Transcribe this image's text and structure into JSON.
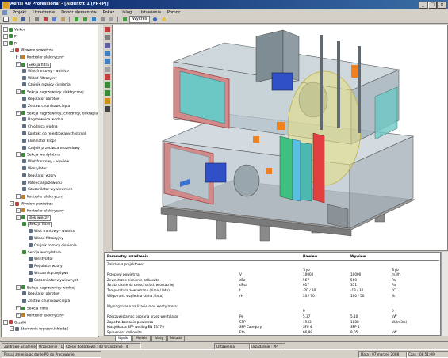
{
  "title": "Aerisl AD Professional - [Aldur.ttt_1 (PP+P)]",
  "menu": [
    "Projekt",
    "Urzadzenie",
    "Dobór elementów",
    "Pokaz",
    "Uslugi",
    "Ustawienia",
    "Pomoc"
  ],
  "toolbar": {
    "wykres_label": "Wykres"
  },
  "tree": [
    {
      "label": "Vaikon",
      "depth": 0,
      "color": "#3a8a3a"
    },
    {
      "label": "P",
      "depth": 0,
      "color": "#3a8a3a"
    },
    {
      "label": "P",
      "depth": 0,
      "color": "#3a8a3a"
    },
    {
      "label": "Wywiew powietrza",
      "depth": 1,
      "color": "#c04040"
    },
    {
      "label": "Kontroler elektryczny",
      "depth": 2,
      "color": "#c08020"
    },
    {
      "label": "Sekcja filtra",
      "depth": 2,
      "color": "#3a8a3a",
      "box": true
    },
    {
      "label": "Wlot frontowy - wolnice",
      "depth": 3,
      "color": "#607080"
    },
    {
      "label": "Wklad filtracyjny",
      "depth": 3,
      "color": "#607080"
    },
    {
      "label": "Czujnik roznicy cisnienia",
      "depth": 3,
      "color": "#607080"
    },
    {
      "label": "Sekcja nagrzewnicy elektrycznej",
      "depth": 2,
      "color": "#3a8a3a"
    },
    {
      "label": "Regulator obrotow",
      "depth": 3,
      "color": "#607080"
    },
    {
      "label": "Zestaw czujnikow ciepla",
      "depth": 3,
      "color": "#607080"
    },
    {
      "label": "Sekcja nagrzewnicy, chlodnicy, odkraplacz",
      "depth": 2,
      "color": "#3a8a3a"
    },
    {
      "label": "Nagrzewnica wodna",
      "depth": 3,
      "color": "#607080"
    },
    {
      "label": "Chlodnica wodna",
      "depth": 3,
      "color": "#607080"
    },
    {
      "label": "Kontakt do rejestrowanych skropli",
      "depth": 3,
      "color": "#607080"
    },
    {
      "label": "Eliminator kropli",
      "depth": 3,
      "color": "#607080"
    },
    {
      "label": "Czujnik przeciwzamrozeniowy",
      "depth": 3,
      "color": "#607080"
    },
    {
      "label": "Sekcja wentylatora",
      "depth": 2,
      "color": "#3a8a3a"
    },
    {
      "label": "Wlot frontowy - wywiew",
      "depth": 3,
      "color": "#607080"
    },
    {
      "label": "Wentylator",
      "depth": 3,
      "color": "#607080"
    },
    {
      "label": "Regulator wzory",
      "depth": 3,
      "color": "#607080"
    },
    {
      "label": "Potencjal przewodu",
      "depth": 3,
      "color": "#607080"
    },
    {
      "label": "Czasonilator wywiewnych",
      "depth": 3,
      "color": "#607080"
    },
    {
      "label": "Kontroler elektryczny",
      "depth": 2,
      "color": "#c08020"
    },
    {
      "label": "Wywiew powietrza",
      "depth": 1,
      "color": "#c04040"
    },
    {
      "label": "Kontroler elektryczny",
      "depth": 2,
      "color": "#c08020"
    },
    {
      "label": "Blok wieczy",
      "depth": 2,
      "color": "#3a8a3a",
      "box": true
    },
    {
      "label": "Sekcja filtra",
      "depth": 3,
      "color": "#3a8a3a",
      "box": true
    },
    {
      "label": "Wlot frontowy - wolnice",
      "depth": 4,
      "color": "#607080"
    },
    {
      "label": "Wklad filtracyjny",
      "depth": 4,
      "color": "#607080"
    },
    {
      "label": "Czujnik roznicy cisnienia",
      "depth": 4,
      "color": "#607080"
    },
    {
      "label": "Sekcja wentylatora",
      "depth": 3,
      "color": "#3a8a3a"
    },
    {
      "label": "Wentylator",
      "depth": 4,
      "color": "#607080"
    },
    {
      "label": "Regulator wzory",
      "depth": 4,
      "color": "#607080"
    },
    {
      "label": "Wskaznikprzeplywu",
      "depth": 4,
      "color": "#607080"
    },
    {
      "label": "Czasonilator wywiewnych",
      "depth": 4,
      "color": "#607080"
    },
    {
      "label": "Sekcja nagrzewnicy wodnej",
      "depth": 2,
      "color": "#3a8a3a"
    },
    {
      "label": "Regulator obrotow",
      "depth": 3,
      "color": "#607080"
    },
    {
      "label": "Zestaw czujnikow ciepla",
      "depth": 3,
      "color": "#607080"
    },
    {
      "label": "Sekcja filtra",
      "depth": 2,
      "color": "#3a8a3a"
    },
    {
      "label": "Kontroler elektryczny",
      "depth": 2,
      "color": "#c08020"
    },
    {
      "label": "Grzalki",
      "depth": 0,
      "color": "#c04040"
    },
    {
      "label": "Sterownik (ogrzew./chlodz.)",
      "depth": 1,
      "color": "#607080"
    }
  ],
  "panel": {
    "headers": {
      "c0": "Parametry urzadzenia",
      "c2": "Nawiew",
      "c4": "Wywiew"
    },
    "rows": [
      {
        "c0": "Zalozenia projektowe:"
      },
      {
        "c0": "",
        "c2": "Tryb",
        "c4": "Tryb"
      },
      {
        "c0": "Przeplyw powietrza",
        "c1": "V",
        "c2": "10000",
        "c3": "10000",
        "c4": "m3/h"
      },
      {
        "c0": "Zewnetrzne cisnienie calkowite",
        "c1": "dPz",
        "c2": "567",
        "c3": "560",
        "c4": "Pa"
      },
      {
        "c0": "Strata cisnienia czesci sklad. w ostatniej",
        "c1": "dPsa",
        "c2": "617",
        "c3": "351",
        "c4": "Pa"
      },
      {
        "c0": "Temperatura zewnetrzna (zima / lato)",
        "c1": "t",
        "c2": "-20 / 30",
        "c3": "-13 / 30",
        "c4": "°C"
      },
      {
        "c0": "Wilgotnosc wzgledna (zima / lato)",
        "c1": "rH",
        "c2": "20 / 70",
        "c3": "100 / 50",
        "c4": "%"
      },
      {
        "c0": ""
      },
      {
        "c0": "Wymaganiana na lizacie moc wentylatora:"
      },
      {
        "c0": "",
        "c2": "0",
        "c4": "0"
      },
      {
        "c0": "Rzeczywistamoc pobrana przez wentylator",
        "c1": "Pe",
        "c2": "5,37",
        "c3": "5,10",
        "c4": "kW"
      },
      {
        "c0": "Zapotrzebowanie powietrza",
        "c1": "SFP",
        "c2": "1933",
        "c3": "1888",
        "c4": "W/(m3/s)"
      },
      {
        "c0": "Klasyfikacja SFP wedlug EN 13779",
        "c1": "SFP Category",
        "c2": "SFP 4",
        "c3": "SFP 4",
        "c4": ""
      },
      {
        "c0": "Sprawnosc calkowita",
        "c1": "Eta",
        "c2": "66,89",
        "c3": "9,05",
        "c4": "kW"
      }
    ]
  },
  "tabs": [
    "Wyniki",
    "Modele",
    "Wady",
    "Notatki"
  ],
  "status": {
    "s1": "Zaldrowe ustalenie",
    "s2": "Urzadzenie : 1",
    "s3": "Czesci dodatkowe : 40 Urzadzenie : 4",
    "s4": "Ustawienia",
    "s5": "Urzadzenie : PP",
    "s6": "Pracuj zmieniajac danie PD do Pracowanie",
    "s7": "Data : 07 marzec 2008",
    "s8": "Czas : 08:51:09"
  },
  "colors": {
    "title_start": "#0a246a",
    "title_end": "#3a6ea5",
    "face": "#d4d0c8"
  }
}
